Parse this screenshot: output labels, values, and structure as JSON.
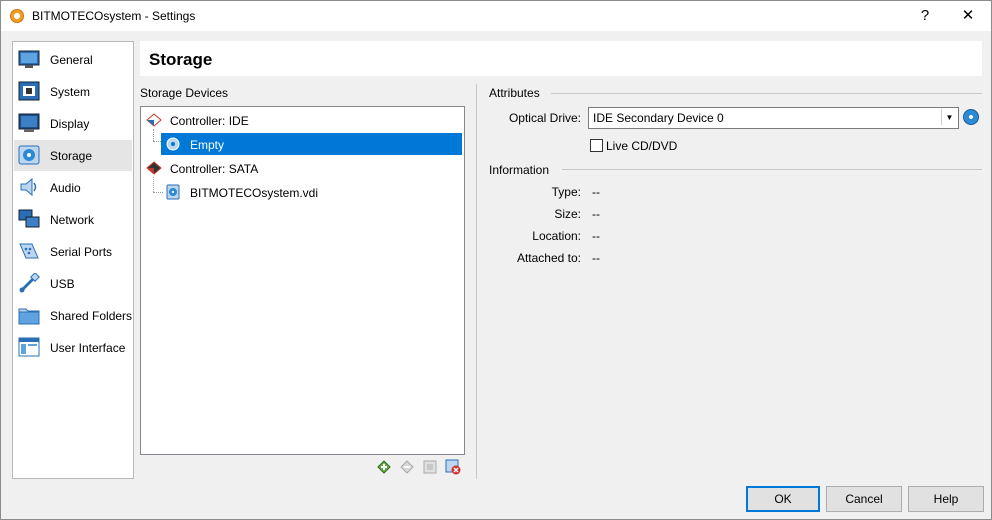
{
  "window": {
    "title": "BITMOTECOsystem - Settings",
    "help_glyph": "?",
    "close_glyph": "✕"
  },
  "nav": {
    "items": [
      {
        "label": "General",
        "icon": "general-icon"
      },
      {
        "label": "System",
        "icon": "system-icon"
      },
      {
        "label": "Display",
        "icon": "display-icon"
      },
      {
        "label": "Storage",
        "icon": "storage-icon",
        "selected": true
      },
      {
        "label": "Audio",
        "icon": "audio-icon"
      },
      {
        "label": "Network",
        "icon": "network-icon"
      },
      {
        "label": "Serial Ports",
        "icon": "serial-ports-icon"
      },
      {
        "label": "USB",
        "icon": "usb-icon"
      },
      {
        "label": "Shared Folders",
        "icon": "shared-folders-icon"
      },
      {
        "label": "User Interface",
        "icon": "user-interface-icon"
      }
    ]
  },
  "header": {
    "title": "Storage"
  },
  "storage": {
    "section_label": "Storage Devices",
    "tree": [
      {
        "label": "Controller: IDE",
        "type": "controller"
      },
      {
        "label": "Empty",
        "type": "optical",
        "selected": true
      },
      {
        "label": "Controller: SATA",
        "type": "controller"
      },
      {
        "label": "BITMOTECOsystem.vdi",
        "type": "disk"
      }
    ],
    "toolbar": [
      "add-controller-icon",
      "remove-controller-icon",
      "add-attachment-icon",
      "remove-attachment-icon"
    ]
  },
  "attributes": {
    "section_label": "Attributes",
    "optical_drive_label": "Optical Drive:",
    "optical_drive_value": "IDE Secondary Device 0",
    "live_cd_label": "Live CD/DVD",
    "live_cd_checked": false
  },
  "information": {
    "section_label": "Information",
    "rows": [
      {
        "label": "Type:",
        "value": "--"
      },
      {
        "label": "Size:",
        "value": "--"
      },
      {
        "label": "Location:",
        "value": "--"
      },
      {
        "label": "Attached to:",
        "value": "--"
      }
    ]
  },
  "buttons": {
    "ok": "OK",
    "cancel": "Cancel",
    "help": "Help"
  },
  "colors": {
    "selection": "#0078d7",
    "accent": "#0078d7"
  }
}
